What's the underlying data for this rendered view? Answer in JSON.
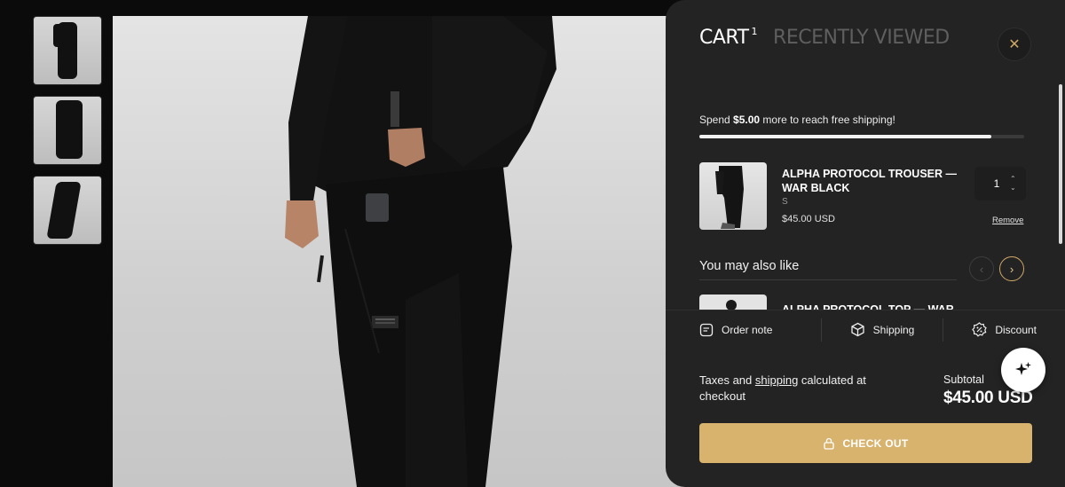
{
  "gallery": {
    "thumbnails": [
      "thumb-1",
      "thumb-2",
      "thumb-3"
    ]
  },
  "cart_drawer": {
    "tab_cart": "CART",
    "cart_count": "1",
    "tab_recent": "RECENTLY VIEWED",
    "close_icon": "close-icon",
    "shipping": {
      "prefix": "Spend ",
      "amount": "$5.00",
      "suffix": " more to reach free shipping!",
      "progress": 0.9
    },
    "item": {
      "title": "ALPHA PROTOCOL TROUSER — WAR BLACK",
      "variant": "S",
      "price": "$45.00 USD",
      "quantity": "1",
      "remove_label": "Remove"
    },
    "recommendations": {
      "heading": "You may also like",
      "first_title": "ALPHA PROTOCOL TOP — WAR"
    },
    "actions": {
      "order_note": "Order note",
      "shipping": "Shipping",
      "discount": "Discount"
    },
    "footer": {
      "tax_prefix": "Taxes and ",
      "tax_link": "shipping",
      "tax_suffix": " calculated at checkout",
      "subtotal_label": "Subtotal",
      "subtotal_value": "$45.00 USD",
      "checkout_label": "CHECK OUT"
    }
  },
  "colors": {
    "accent": "#d8b36e",
    "drawer_bg": "#232323",
    "page_bg": "#0b0b0b"
  }
}
